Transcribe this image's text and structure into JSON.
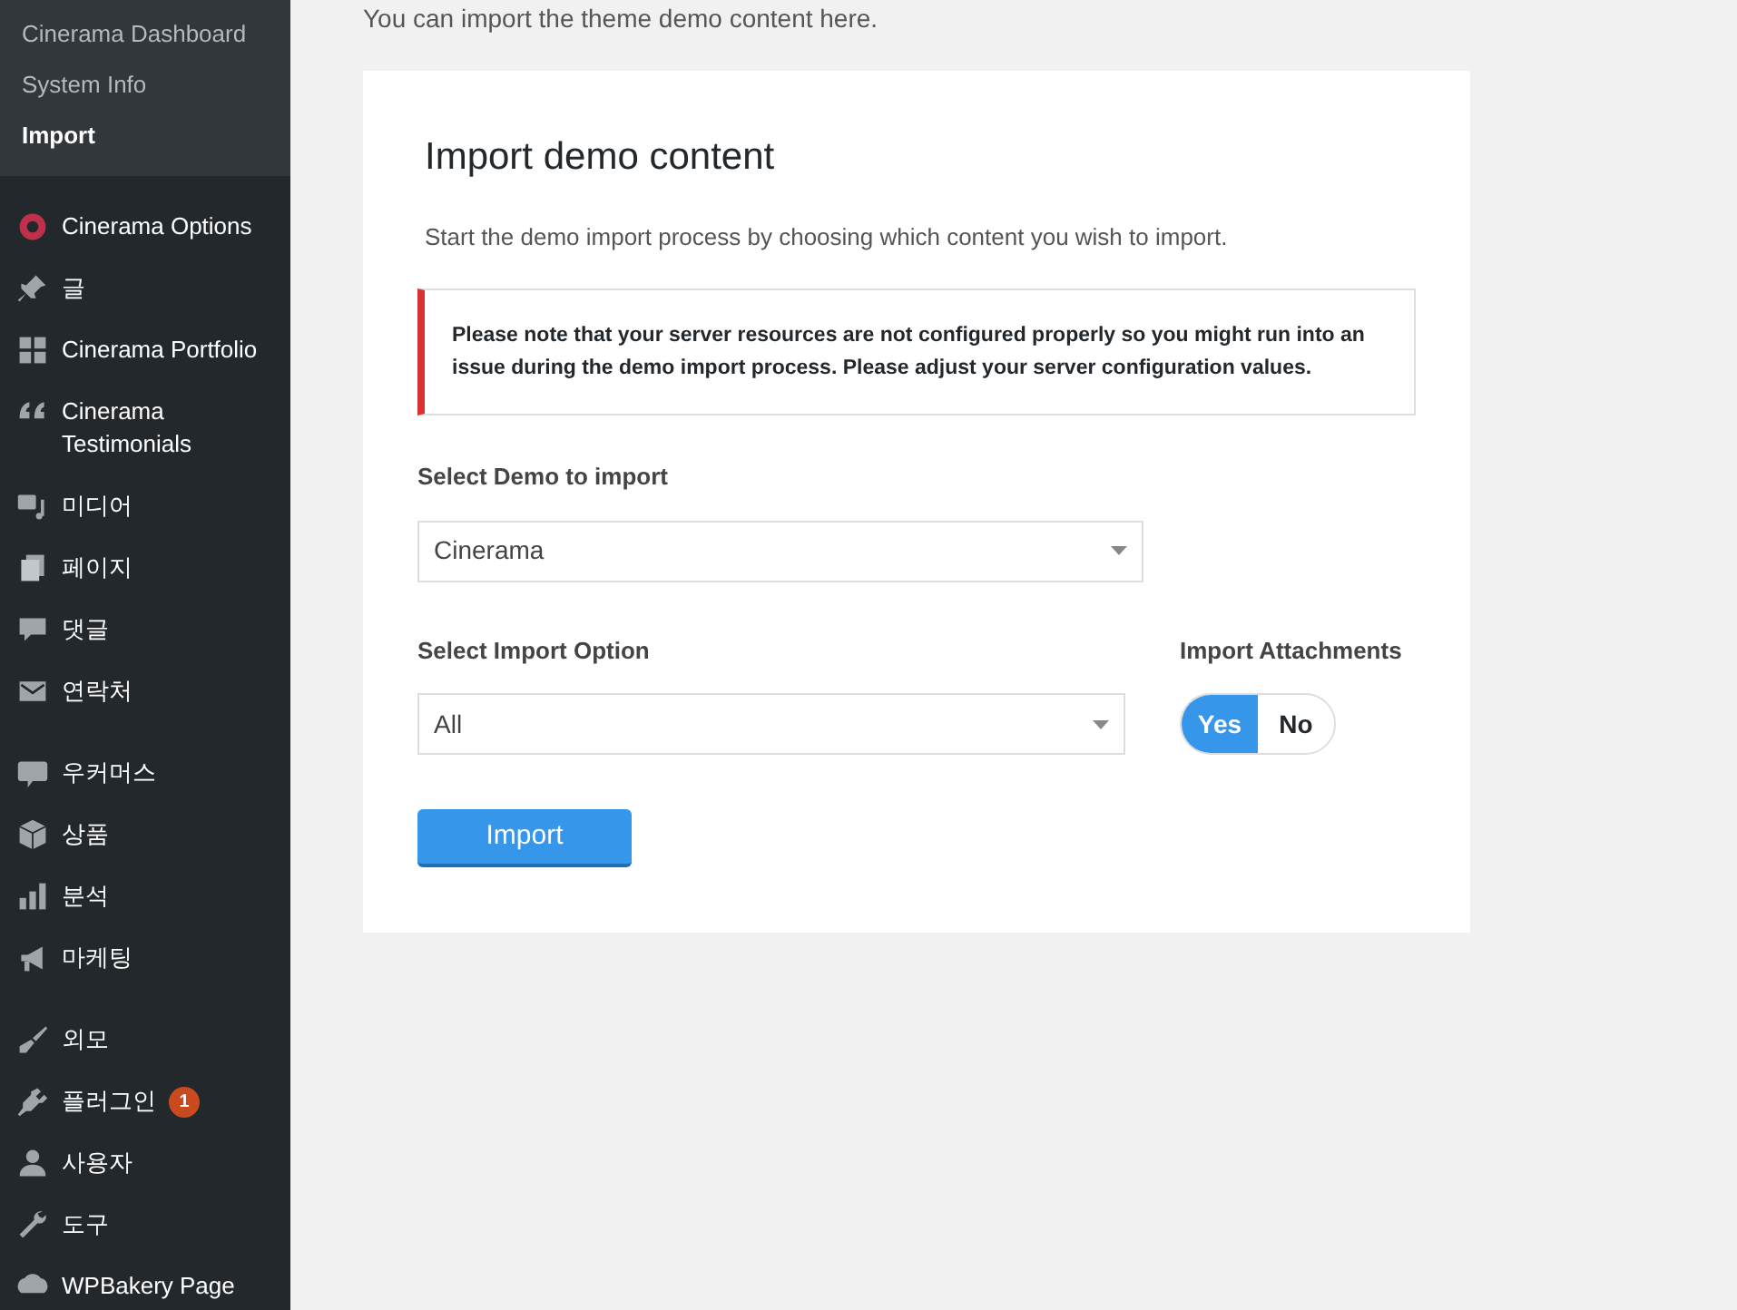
{
  "sidebar": {
    "submenu": [
      {
        "label": "Cinerama Dashboard",
        "selected": false
      },
      {
        "label": "System Info",
        "selected": false
      },
      {
        "label": "Import",
        "selected": true
      }
    ],
    "menu_groups": [
      [
        {
          "label": "Cinerama Options"
        },
        {
          "label": "글"
        },
        {
          "label": "Cinerama Portfolio"
        },
        {
          "label": "Cinerama Testimonials"
        },
        {
          "label": "미디어"
        },
        {
          "label": "페이지"
        },
        {
          "label": "댓글"
        },
        {
          "label": "연락처"
        }
      ],
      [
        {
          "label": "우커머스"
        },
        {
          "label": "상품"
        },
        {
          "label": "분석"
        },
        {
          "label": "마케팅"
        }
      ],
      [
        {
          "label": "외모"
        },
        {
          "label": "플러그인",
          "badge": "1"
        },
        {
          "label": "사용자"
        },
        {
          "label": "도구"
        },
        {
          "label": "WPBakery Page"
        }
      ]
    ]
  },
  "intro": "You can import the theme demo content here.",
  "card": {
    "title": "Import demo content",
    "description": "Start the demo import process by choosing which content you wish to import.",
    "notice": "Please note that your server resources are not configured properly so you might run into an issue during the demo import process. Please adjust your server configuration values.",
    "demo_select": {
      "label": "Select Demo to import",
      "value": "Cinerama"
    },
    "option_select": {
      "label": "Select Import Option",
      "value": "All"
    },
    "attachments": {
      "label": "Import Attachments",
      "options": [
        {
          "label": "Yes",
          "selected": true
        },
        {
          "label": "No",
          "selected": false
        }
      ]
    },
    "button": "Import"
  }
}
